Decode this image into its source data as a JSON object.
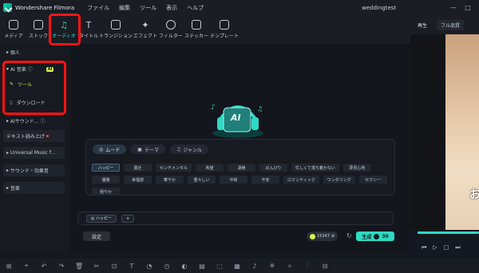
{
  "titlebar": {
    "app_name": "Wondershare Filmora",
    "menus": [
      "ファイル",
      "編集",
      "ツール",
      "表示",
      "ヘルプ"
    ],
    "project_name": "weddingtest"
  },
  "toolbar": {
    "tabs": [
      {
        "label": "メディア",
        "icon": "media-icon"
      },
      {
        "label": "ストック",
        "icon": "stock-icon"
      },
      {
        "label": "オーディオ",
        "icon": "music-note-icon",
        "active": true
      },
      {
        "label": "タイトル",
        "icon": "title-icon"
      },
      {
        "label": "トランジション",
        "icon": "transition-icon"
      },
      {
        "label": "エフェクト",
        "icon": "effect-icon"
      },
      {
        "label": "フィルター",
        "icon": "filter-icon"
      },
      {
        "label": "ステッカー",
        "icon": "sticker-icon"
      },
      {
        "label": "テンプレート",
        "icon": "template-icon"
      }
    ]
  },
  "sidebar": {
    "personal": "個人",
    "ai_music": "AI 音楽",
    "ai_badge": "AI",
    "tools": "ツール",
    "download": "ダウンロード",
    "ai_sound": "AIサウンド...",
    "tts": "テキスト読み上げ",
    "universal": "Universal Music f...",
    "sfx": "サウンド・効果音",
    "music": "音楽"
  },
  "main": {
    "ai_logo_text": "AI",
    "tabs": [
      "ムード",
      "テーマ",
      "ジャンル"
    ],
    "moods": [
      "ハッピー",
      "勇壮",
      "センチメンタル",
      "希望",
      "凄絶",
      "のんびり",
      "忙しくて落ち着かない",
      "夢見心地",
      "優雅",
      "幸福感",
      "華やか",
      "重々しい",
      "平和",
      "不安",
      "ロマンティック",
      "ワンダリング",
      "セクシー",
      "穏やか"
    ],
    "selected_tag": "ハッピー",
    "add_label": "+",
    "settings_label": "設定",
    "credits": "15347",
    "generate_label": "生成",
    "generate_cost": "30"
  },
  "preview": {
    "tab_playback": "再生",
    "quality": "フル品質",
    "overlay_char": "お"
  },
  "colors": {
    "accent": "#2fd9c4",
    "highlight": "#ff1414",
    "ai_badge": "#d8f44a"
  }
}
